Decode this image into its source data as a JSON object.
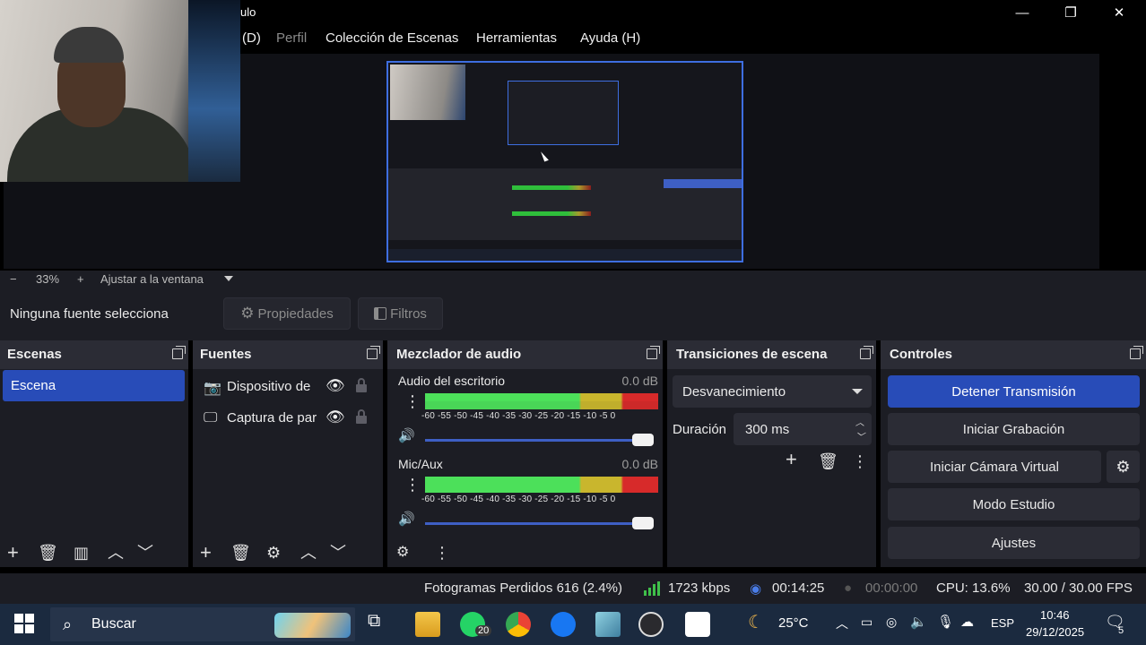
{
  "window": {
    "title": "ulo",
    "minimize": "—",
    "maximize": "❐",
    "close": "✕"
  },
  "menu": {
    "items": [
      {
        "label": "(D)",
        "disabled": false
      },
      {
        "label": "Perfil",
        "disabled": true
      },
      {
        "label": "Colección de Escenas",
        "disabled": false
      },
      {
        "label": "Herramientas",
        "disabled": false
      },
      {
        "label": "Ayuda (H)",
        "disabled": false
      }
    ]
  },
  "zoom": {
    "minus": "−",
    "level": "33%",
    "plus": "+",
    "fit_label": "Ajustar a la ventana"
  },
  "context": {
    "no_source": "Ninguna fuente selecciona",
    "properties": "Propiedades",
    "filters": "Filtros"
  },
  "scenes": {
    "title": "Escenas",
    "items": [
      "Escena"
    ]
  },
  "sources": {
    "title": "Fuentes",
    "items": [
      {
        "label": "Dispositivo de",
        "icon": "camera-icon"
      },
      {
        "label": "Captura de par",
        "icon": "monitor-icon"
      }
    ]
  },
  "mixer": {
    "title": "Mezclador de audio",
    "tracks": [
      {
        "name": "Audio del escritorio",
        "db": "0.0 dB",
        "level": 1.0
      },
      {
        "name": "Mic/Aux",
        "db": "0.0 dB",
        "level": 1.0
      }
    ],
    "scale": [
      "-60",
      "-55",
      "-50",
      "-45",
      "-40",
      "-35",
      "-30",
      "-25",
      "-20",
      "-15",
      "-10",
      "-5",
      "0"
    ]
  },
  "transitions": {
    "title": "Transiciones de escena",
    "selected": "Desvanecimiento",
    "duration_label": "Duración",
    "duration_value": "300 ms"
  },
  "controls": {
    "title": "Controles",
    "stop_stream": "Detener Transmisión",
    "start_recording": "Iniciar Grabación",
    "start_virtual_cam": "Iniciar Cámara Virtual",
    "studio_mode": "Modo Estudio",
    "settings": "Ajustes"
  },
  "status": {
    "dropped_frames": "Fotogramas Perdidos 616 (2.4%)",
    "bitrate": "1723 kbps",
    "stream_time": "00:14:25",
    "rec_time": "00:00:00",
    "cpu": "CPU: 13.6%",
    "fps": "30.00 / 30.00 FPS"
  },
  "taskbar": {
    "search_placeholder": "Buscar",
    "whatsapp_badge": "20",
    "weather": "25°C",
    "language": "ESP",
    "time": "10:46",
    "date": "29/12/2025",
    "notifications": "5"
  },
  "colors": {
    "accent": "#284cb8",
    "dock_bg": "#1c1d24",
    "header_bg": "#2b2c35"
  }
}
